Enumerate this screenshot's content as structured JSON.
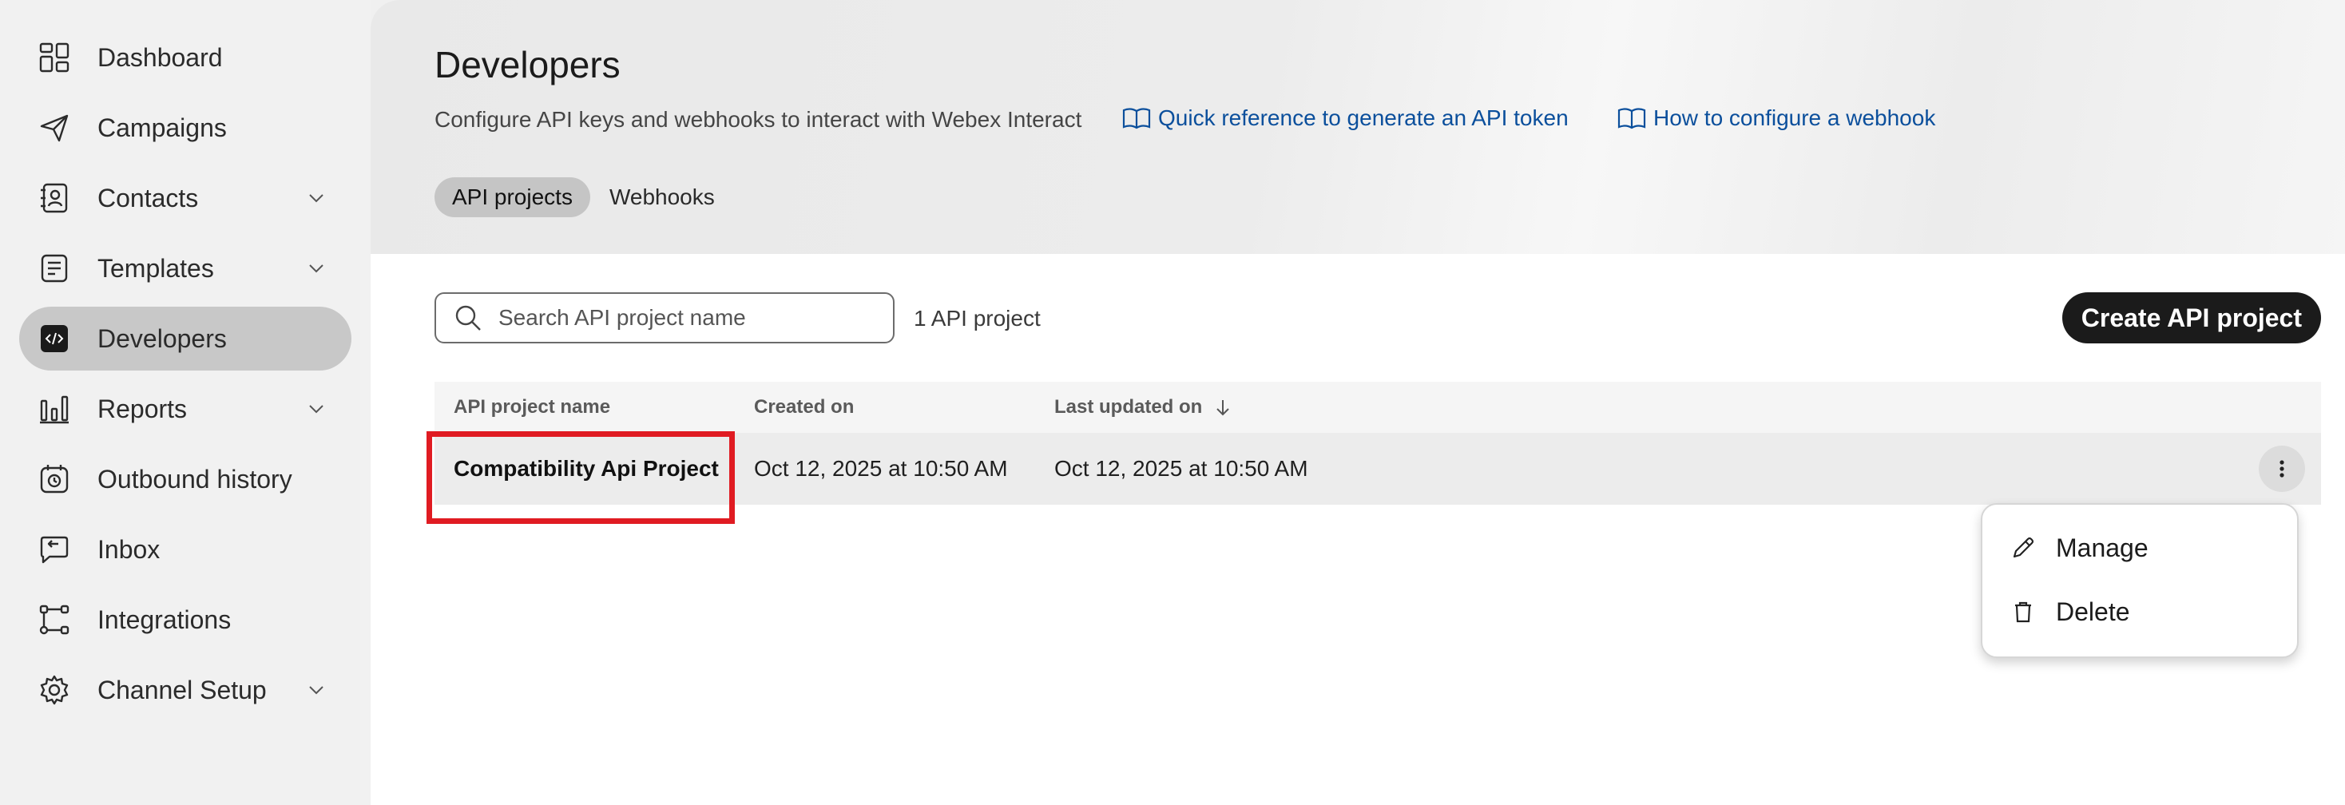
{
  "sidebar": {
    "items": [
      {
        "label": "Dashboard",
        "icon": "dashboard-icon",
        "chevron": false,
        "active": false
      },
      {
        "label": "Campaigns",
        "icon": "paper-plane-icon",
        "chevron": false,
        "active": false
      },
      {
        "label": "Contacts",
        "icon": "contacts-icon",
        "chevron": true,
        "active": false
      },
      {
        "label": "Templates",
        "icon": "templates-icon",
        "chevron": true,
        "active": false
      },
      {
        "label": "Developers",
        "icon": "code-icon",
        "chevron": false,
        "active": true
      },
      {
        "label": "Reports",
        "icon": "bar-chart-icon",
        "chevron": true,
        "active": false
      },
      {
        "label": "Outbound history",
        "icon": "calendar-history-icon",
        "chevron": false,
        "active": false
      },
      {
        "label": "Inbox",
        "icon": "inbox-icon",
        "chevron": false,
        "active": false
      },
      {
        "label": "Integrations",
        "icon": "integrations-icon",
        "chevron": false,
        "active": false
      },
      {
        "label": "Channel Setup",
        "icon": "gear-icon",
        "chevron": true,
        "active": false
      }
    ]
  },
  "header": {
    "title": "Developers",
    "subtitle": "Configure API keys and webhooks to interact with Webex Interact",
    "links": {
      "api_token": "Quick reference to generate an API token",
      "webhook": "How to configure a webhook"
    },
    "tabs": [
      {
        "label": "API projects",
        "active": true
      },
      {
        "label": "Webhooks",
        "active": false
      }
    ]
  },
  "toolbar": {
    "search_placeholder": "Search API project name",
    "count": "1 API project",
    "create_label": "Create API project"
  },
  "table": {
    "columns": [
      "API project name",
      "Created on",
      "Last updated on"
    ],
    "rows": [
      {
        "name": "Compatibility Api Project",
        "created": "Oct 12, 2025 at 10:50 AM",
        "updated": "Oct 12, 2025 at 10:50 AM"
      }
    ]
  },
  "menu": {
    "items": [
      {
        "label": "Manage",
        "icon": "pencil-icon"
      },
      {
        "label": "Delete",
        "icon": "trash-icon"
      }
    ]
  },
  "colors": {
    "accent_link": "#0b4f9c",
    "highlight": "#e01b22",
    "primary_button": "#1b1b1b"
  }
}
